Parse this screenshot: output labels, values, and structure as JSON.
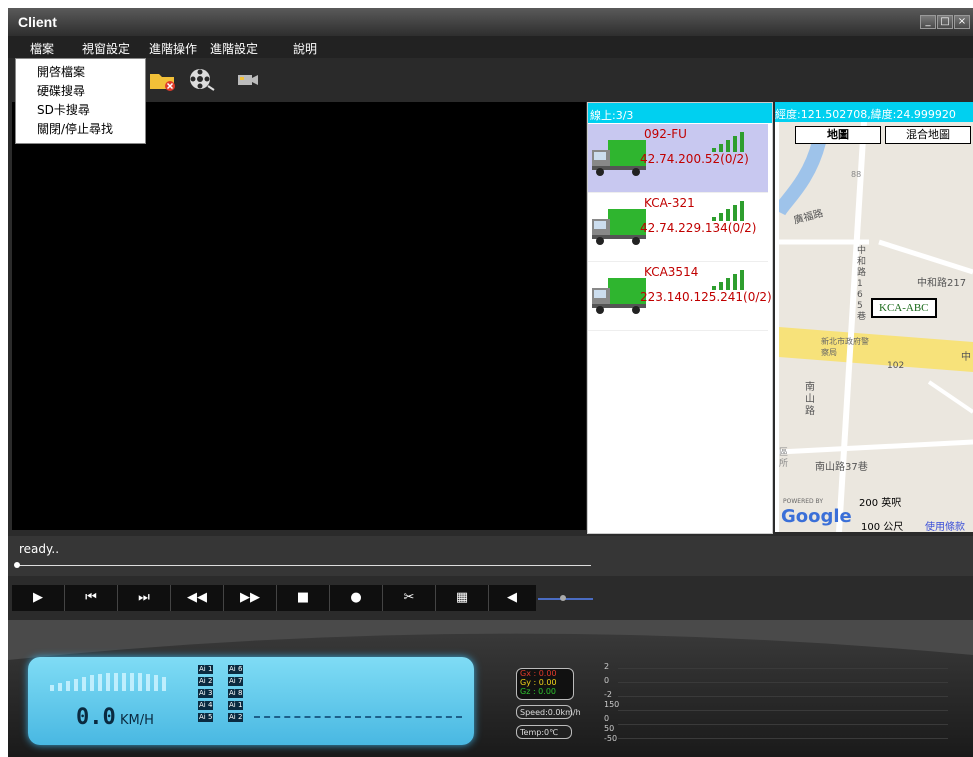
{
  "window": {
    "title": "Client"
  },
  "menu": [
    "檔案",
    "視窗設定",
    "進階操作",
    "進階設定",
    "說明"
  ],
  "file_menu": [
    "開啓檔案",
    "硬碟搜尋",
    "SD卡搜尋",
    "關閉/停止尋找"
  ],
  "toolbar": [
    "folder-delete-icon",
    "reel-icon",
    "camera-icon"
  ],
  "vehicle_list": {
    "header": "線上:3/3",
    "items": [
      {
        "name": "092-FU",
        "ip": "42.74.200.52(0/2)"
      },
      {
        "name": "KCA-321",
        "ip": "42.74.229.134(0/2)"
      },
      {
        "name": "KCA3514",
        "ip": "223.140.125.241(0/2)"
      }
    ]
  },
  "map": {
    "coords": "經度:121.502708,緯度:24.999920",
    "btn_map": "地圖",
    "btn_hybrid": "混合地圖",
    "marker": "KCA-ABC",
    "labels": {
      "road1": "廣福路",
      "road2": "中和路217",
      "road3": "中",
      "lane": "中和路165巷",
      "police": "新北市政府警察局",
      "num": "102",
      "nanshan": "南山路",
      "nanshan37": "南山路37巷",
      "misc": "區所",
      "num2": "88"
    },
    "scale_mi": "200 英呎",
    "scale_km": "100 公尺",
    "powered": "POWERED BY",
    "google": "Google",
    "terms": "使用條款"
  },
  "status": {
    "text": "ready.."
  },
  "controls": [
    "play-icon",
    "prev-icon",
    "next-icon",
    "rewind-icon",
    "fast-forward-icon",
    "stop-icon",
    "record-icon",
    "cut-icon",
    "grid-icon",
    "volume-icon"
  ],
  "dashboard": {
    "speed": "0.0",
    "unit": "KM/H",
    "indicators": [
      "Ai 1",
      "Ai 2",
      "Ai 3",
      "Ai 4",
      "Ai 5",
      "Ai 6",
      "Ai 7",
      "Ai 8",
      "Ai 1",
      "Ai 2"
    ],
    "gx": "Gx : 0.00",
    "gy": "Gy : 0.00",
    "gz": "Gz : 0.00",
    "speed_box": "Speed:0.0km/h",
    "temp": "Temp:0℃",
    "axis_labels": [
      "2",
      "0",
      "-2",
      "150",
      "0",
      "50",
      "-50"
    ]
  }
}
